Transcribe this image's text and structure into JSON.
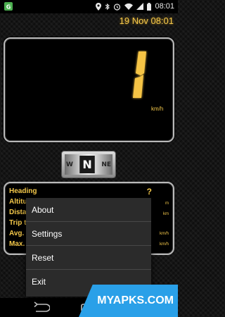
{
  "status_bar": {
    "time": "08:01",
    "left_icon": "app-notification-icon",
    "icons": [
      "location-icon",
      "bluetooth-icon",
      "alarm-icon",
      "wifi-icon",
      "signal-icon",
      "battery-icon"
    ]
  },
  "header": {
    "datetime": "19 Nov 08:01"
  },
  "speedometer": {
    "speed": "1",
    "unit": "km/h",
    "accent": "#f4c84a"
  },
  "compass": {
    "left": "W",
    "center": "N",
    "right": "NE"
  },
  "info": {
    "rows": [
      {
        "label": "Heading",
        "value": "?"
      },
      {
        "label": "Altitude",
        "value": "m"
      },
      {
        "label": "Distance",
        "value": "km"
      },
      {
        "label": "Trip time",
        "value": ""
      },
      {
        "label": "Avg. speed",
        "value": "km/h"
      },
      {
        "label": "Max. speed",
        "value": "km/h"
      }
    ]
  },
  "menu": {
    "items": [
      {
        "label": "About"
      },
      {
        "label": "Settings"
      },
      {
        "label": "Reset"
      },
      {
        "label": "Exit"
      }
    ]
  },
  "navbar": {
    "back_icon": "back-icon",
    "home_icon": "home-icon"
  },
  "watermark": {
    "text": "MYAPKS.COM"
  }
}
